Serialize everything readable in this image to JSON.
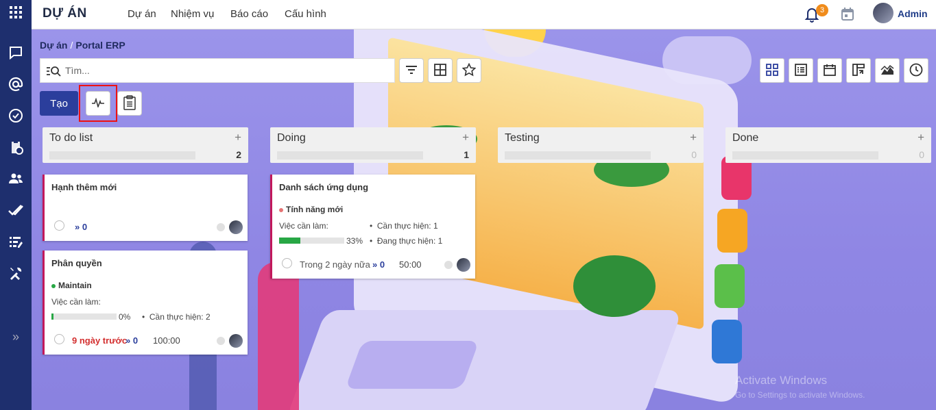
{
  "topbar": {
    "brand": "DỰ ÁN",
    "menu": [
      "Dự án",
      "Nhiệm vụ",
      "Báo cáo",
      "Cấu hình"
    ],
    "notification_count": "3",
    "user": "Admin"
  },
  "breadcrumb": {
    "parent": "Dự án",
    "separator": "/",
    "current": "Portal ERP"
  },
  "search": {
    "placeholder": "Tìm..."
  },
  "toolbar": {
    "create_label": "Tạo"
  },
  "columns": [
    {
      "title": "To do list",
      "count": "2"
    },
    {
      "title": "Doing",
      "count": "1"
    },
    {
      "title": "Testing",
      "count": "0"
    },
    {
      "title": "Done",
      "count": "0"
    }
  ],
  "cards": {
    "hanh": {
      "title": "Hạnh thêm mới",
      "subtasks": "0"
    },
    "phan": {
      "title": "Phân quyền",
      "tag": "Maintain",
      "tag_color": "#28a745",
      "todo_label": "Việc cần làm:",
      "progress": 0,
      "progress_text": "0%",
      "assigned": "Cần thực hiện: 2",
      "due": "9 ngày trước",
      "subtasks": "0",
      "duration": "100:00"
    },
    "danh": {
      "title": "Danh sách ứng dụng",
      "tag": "Tính năng mới",
      "tag_color": "#e57373",
      "todo_label": "Việc cần làm:",
      "progress": 33,
      "progress_text": "33%",
      "assigned": "Cần thực hiện: 1",
      "in_progress": "Đang thực hiện: 1",
      "due": "Trong 2 ngày nữa",
      "subtasks": "0",
      "duration": "50:00"
    }
  },
  "watermark": {
    "line1": "Activate Windows",
    "line2": "Go to Settings to activate Windows."
  }
}
